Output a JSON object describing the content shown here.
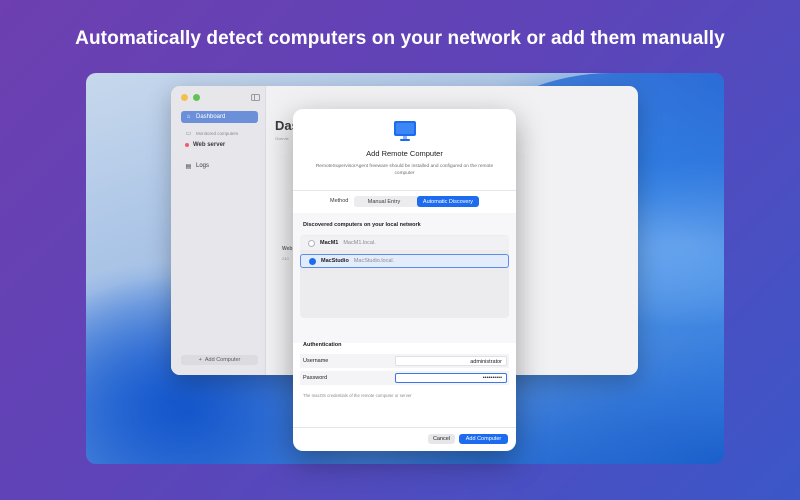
{
  "headline": "Automatically detect computers on your network or add them manually",
  "app": {
    "sidebar": {
      "items": [
        {
          "label": "Dashboard",
          "icon": "house-icon"
        },
        {
          "label": "Monitored computers"
        },
        {
          "label": "Web server"
        },
        {
          "label": "Logs",
          "icon": "document-icon"
        }
      ],
      "add_button": "Add Computer"
    },
    "main": {
      "title": "Das",
      "subtitle": "Overvie",
      "card_label": "Web",
      "card_sub": "210"
    }
  },
  "sheet": {
    "title": "Add Remote Computer",
    "description": "RemoteSupervisorAgent freeware should be installed and configured on the remote computer",
    "method_label": "Method",
    "method_options": [
      "Manual Entry",
      "Automatic Discovery"
    ],
    "method_selected": "Automatic Discovery",
    "discovered_heading": "Discovered computers on your local network",
    "computers": [
      {
        "name": "MacM1",
        "address": "MacM1.local.",
        "selected": false
      },
      {
        "name": "MacStudio",
        "address": "MacStudio.local.",
        "selected": true
      }
    ],
    "auth_heading": "Authentication",
    "username_label": "Username",
    "username_value": "administrator",
    "password_label": "Password",
    "password_value": "••••••••••",
    "hint": "The macOS credentials of the remote computer or server",
    "cancel_label": "Cancel",
    "add_label": "Add Computer"
  },
  "colors": {
    "accent": "#1d6cf0",
    "sidebar_selected": "#6b8fd8"
  }
}
